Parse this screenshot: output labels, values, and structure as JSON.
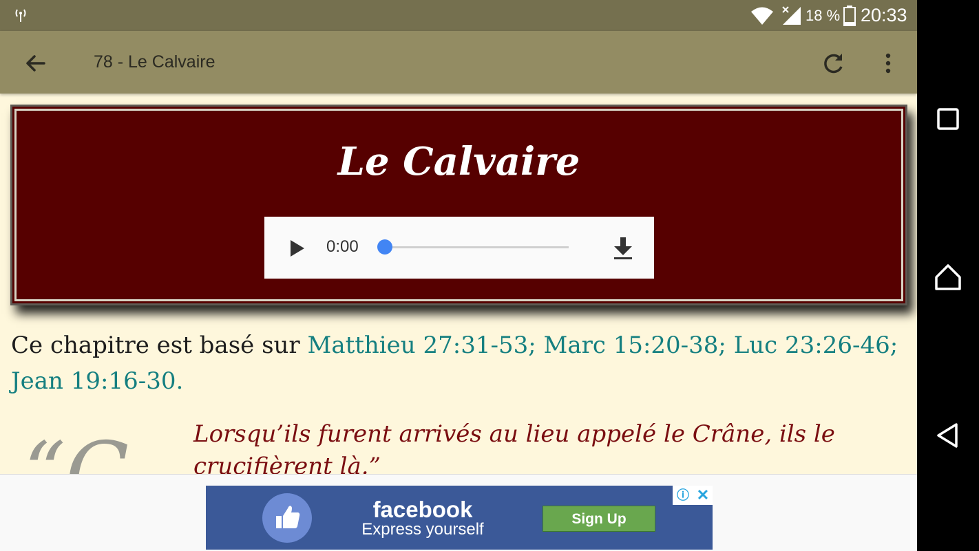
{
  "status_bar": {
    "battery_percent": "18 %",
    "time": "20:33"
  },
  "app_bar": {
    "title": "78 - Le Calvaire",
    "icons": [
      "back-arrow-icon",
      "refresh-icon",
      "more-vert-icon"
    ]
  },
  "header": {
    "title": "Le Calvaire"
  },
  "audio_player": {
    "time": "0:00",
    "progress": 0
  },
  "intro": {
    "text": "Ce chapitre est basé sur",
    "references": "Matthieu 27:31-53; Marc 15:20-38; Luc 23:26-46; Jean 19:16-30."
  },
  "quote": {
    "drop_cap": "“C",
    "text": "Lorsqu’ils furent arrivés au lieu appelé le Crâne, ils le crucifièrent là.”"
  },
  "ad": {
    "brand": "facebook",
    "tagline": "Express yourself",
    "button": "Sign Up"
  },
  "colors": {
    "status_bar": "#75704f",
    "app_bar": "#938c63",
    "page_background": "#fef7dc",
    "header_background": "#560000",
    "reference_link": "#157f80",
    "quote_text": "#7a0e11",
    "audio_thumb": "#4285f4",
    "facebook_blue": "#3b5998",
    "signup_green": "#69a74e"
  }
}
